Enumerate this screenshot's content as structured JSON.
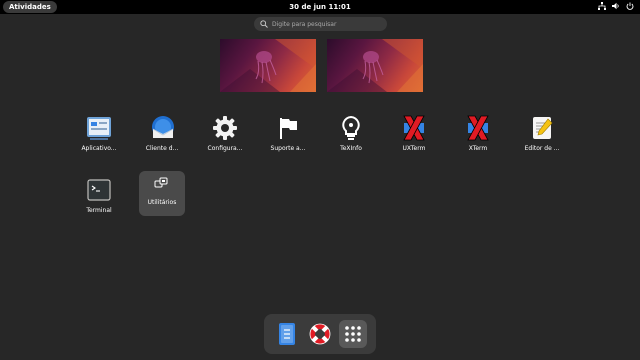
{
  "topbar": {
    "activities_label": "Atividades",
    "clock": "30 de jun  11:01",
    "tray_icons": [
      "network-icon",
      "volume-icon",
      "power-icon"
    ]
  },
  "search": {
    "placeholder": "Digite para pesquisar"
  },
  "workspaces": [
    "workspace-1",
    "workspace-2"
  ],
  "apps": [
    {
      "label": "Aplicativo...",
      "icon": "software-icon"
    },
    {
      "label": "Cliente d...",
      "icon": "mail-client-icon"
    },
    {
      "label": "Configura...",
      "icon": "settings-gear-icon"
    },
    {
      "label": "Suporte a...",
      "icon": "flag-icon"
    },
    {
      "label": "TeXInfo",
      "icon": "lightbulb-icon"
    },
    {
      "label": "UXTerm",
      "icon": "x-logo-icon"
    },
    {
      "label": "XTerm",
      "icon": "x-logo-icon"
    },
    {
      "label": "Editor de ...",
      "icon": "text-editor-icon"
    },
    {
      "label": "Terminal",
      "icon": "terminal-icon"
    }
  ],
  "folder": {
    "label": "Utilitários",
    "icon": "folder-grid-icon"
  },
  "dock": [
    {
      "name": "files",
      "icon": "file-manager-icon"
    },
    {
      "name": "help",
      "icon": "lifebuoy-icon"
    },
    {
      "name": "show-apps",
      "icon": "app-grid-icon",
      "active": true
    }
  ],
  "colors": {
    "background": "#272727",
    "topbar": "#000000",
    "accent_blue": "#3584e4",
    "help_red": "#e01b24"
  }
}
